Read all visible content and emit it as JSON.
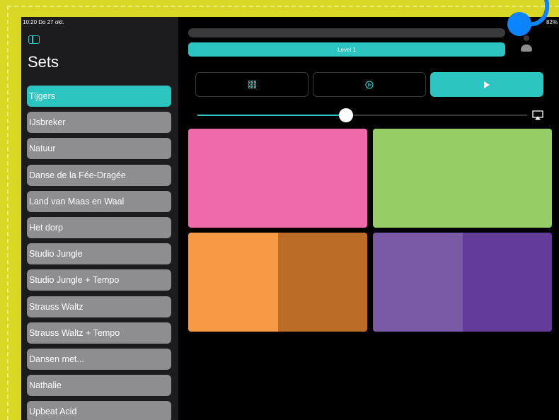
{
  "status": {
    "time": "10:20  Do 27 okt.",
    "battery": "82%"
  },
  "sidebar": {
    "title": "Sets",
    "toggle_icon": "sidebar-icon",
    "items": [
      {
        "label": "Tijgers",
        "active": true
      },
      {
        "label": "IJsbreker"
      },
      {
        "label": "Natuur"
      },
      {
        "label": "Danse de la Fée-Dragée"
      },
      {
        "label": "Land van Maas en Waal"
      },
      {
        "label": "Het dorp"
      },
      {
        "label": "Studio Jungle"
      },
      {
        "label": "Studio Jungle + Tempo"
      },
      {
        "label": "Strauss Waltz"
      },
      {
        "label": "Strauss Waltz + Tempo"
      },
      {
        "label": "Dansen met..."
      },
      {
        "label": "Nathalie"
      },
      {
        "label": "Upbeat Acid"
      }
    ]
  },
  "main": {
    "level_label": "Level 1",
    "buttons": {
      "grid_icon": "grid-icon",
      "settings_icon": "gear-icon",
      "play_icon": "play-icon"
    },
    "slider_value": 0.45,
    "airplay_icon": "airplay-icon"
  },
  "colors": {
    "accent": "#2bc4c0",
    "pink": "#ef6aa8",
    "green": "#96cd66",
    "orange": "#f79a45",
    "orange_dark": "#bb6d27",
    "purple": "#7a5aa7",
    "purple_dark": "#633b99"
  }
}
